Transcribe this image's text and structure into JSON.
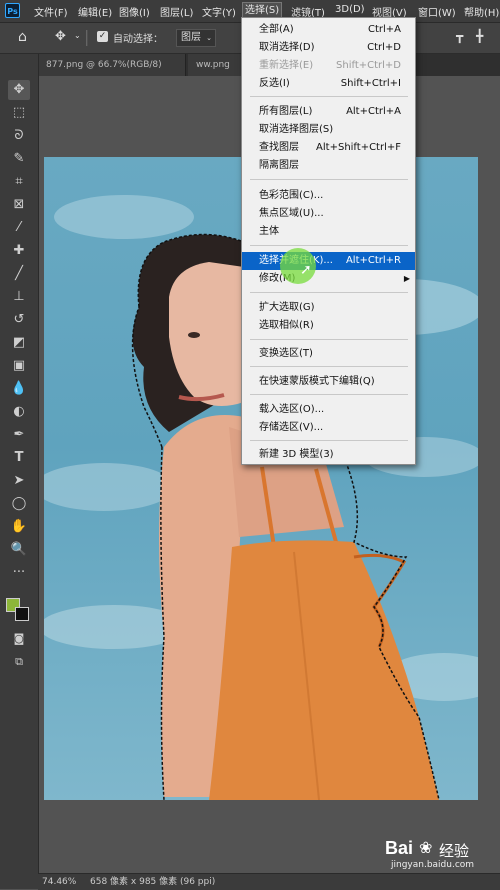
{
  "app": {
    "logo": "Ps"
  },
  "menubar": {
    "items": [
      "文件(F)",
      "编辑(E)",
      "图像(I)",
      "图层(L)",
      "文字(Y)",
      "选择(S)",
      "滤镜(T)",
      "3D(D)",
      "视图(V)",
      "窗口(W)",
      "帮助(H)"
    ],
    "active": "选择(S)"
  },
  "options": {
    "auto_select_label": "自动选择：",
    "auto_select_checked": true,
    "target_value": "图层"
  },
  "tabs": [
    "877.png @ 66.7%(RGB/8)",
    "ww.png"
  ],
  "tools": [
    "move-icon",
    "marquee-icon",
    "lasso-icon",
    "quick-select-icon",
    "crop-icon",
    "frame-icon",
    "eyedropper-icon",
    "healing-icon",
    "brush-icon",
    "stamp-icon",
    "history-brush-icon",
    "eraser-icon",
    "gradient-icon",
    "blur-icon",
    "dodge-icon",
    "pen-icon",
    "type-icon",
    "path-select-icon",
    "shape-icon",
    "hand-icon",
    "zoom-icon",
    "more-icon"
  ],
  "colors": {
    "foreground": "#8db63a",
    "background": "#111111",
    "highlight": "#0a64c8",
    "menu_bg": "#f0f0f0"
  },
  "select_menu": {
    "groups": [
      [
        {
          "label": "全部(A)",
          "shortcut": "Ctrl+A"
        },
        {
          "label": "取消选择(D)",
          "shortcut": "Ctrl+D"
        },
        {
          "label": "重新选择(E)",
          "shortcut": "Shift+Ctrl+D",
          "disabled": true
        },
        {
          "label": "反选(I)",
          "shortcut": "Shift+Ctrl+I"
        }
      ],
      [
        {
          "label": "所有图层(L)",
          "shortcut": "Alt+Ctrl+A"
        },
        {
          "label": "取消选择图层(S)",
          "shortcut": ""
        },
        {
          "label": "查找图层",
          "shortcut": "Alt+Shift+Ctrl+F"
        },
        {
          "label": "隔离图层",
          "shortcut": ""
        }
      ],
      [
        {
          "label": "色彩范围(C)...",
          "shortcut": ""
        },
        {
          "label": "焦点区域(U)...",
          "shortcut": ""
        },
        {
          "label": "主体",
          "shortcut": ""
        }
      ],
      [
        {
          "label": "选择并遮住(K)...",
          "shortcut": "Alt+Ctrl+R",
          "highlighted": true
        },
        {
          "label": "修改(M)",
          "shortcut": "",
          "submenu": true
        }
      ],
      [
        {
          "label": "扩大选取(G)",
          "shortcut": ""
        },
        {
          "label": "选取相似(R)",
          "shortcut": ""
        }
      ],
      [
        {
          "label": "变换选区(T)",
          "shortcut": ""
        }
      ],
      [
        {
          "label": "在快速蒙版模式下编辑(Q)",
          "shortcut": ""
        }
      ],
      [
        {
          "label": "载入选区(O)...",
          "shortcut": ""
        },
        {
          "label": "存储选区(V)...",
          "shortcut": ""
        }
      ],
      [
        {
          "label": "新建 3D 模型(3)",
          "shortcut": ""
        }
      ]
    ]
  },
  "status": {
    "zoom": "74.46%",
    "doc_info": "658 像素 x 985 像素 (96 ppi)"
  },
  "watermark": {
    "brand": "Bai",
    "brand2": "经验",
    "url": "jingyan.baidu.com"
  }
}
